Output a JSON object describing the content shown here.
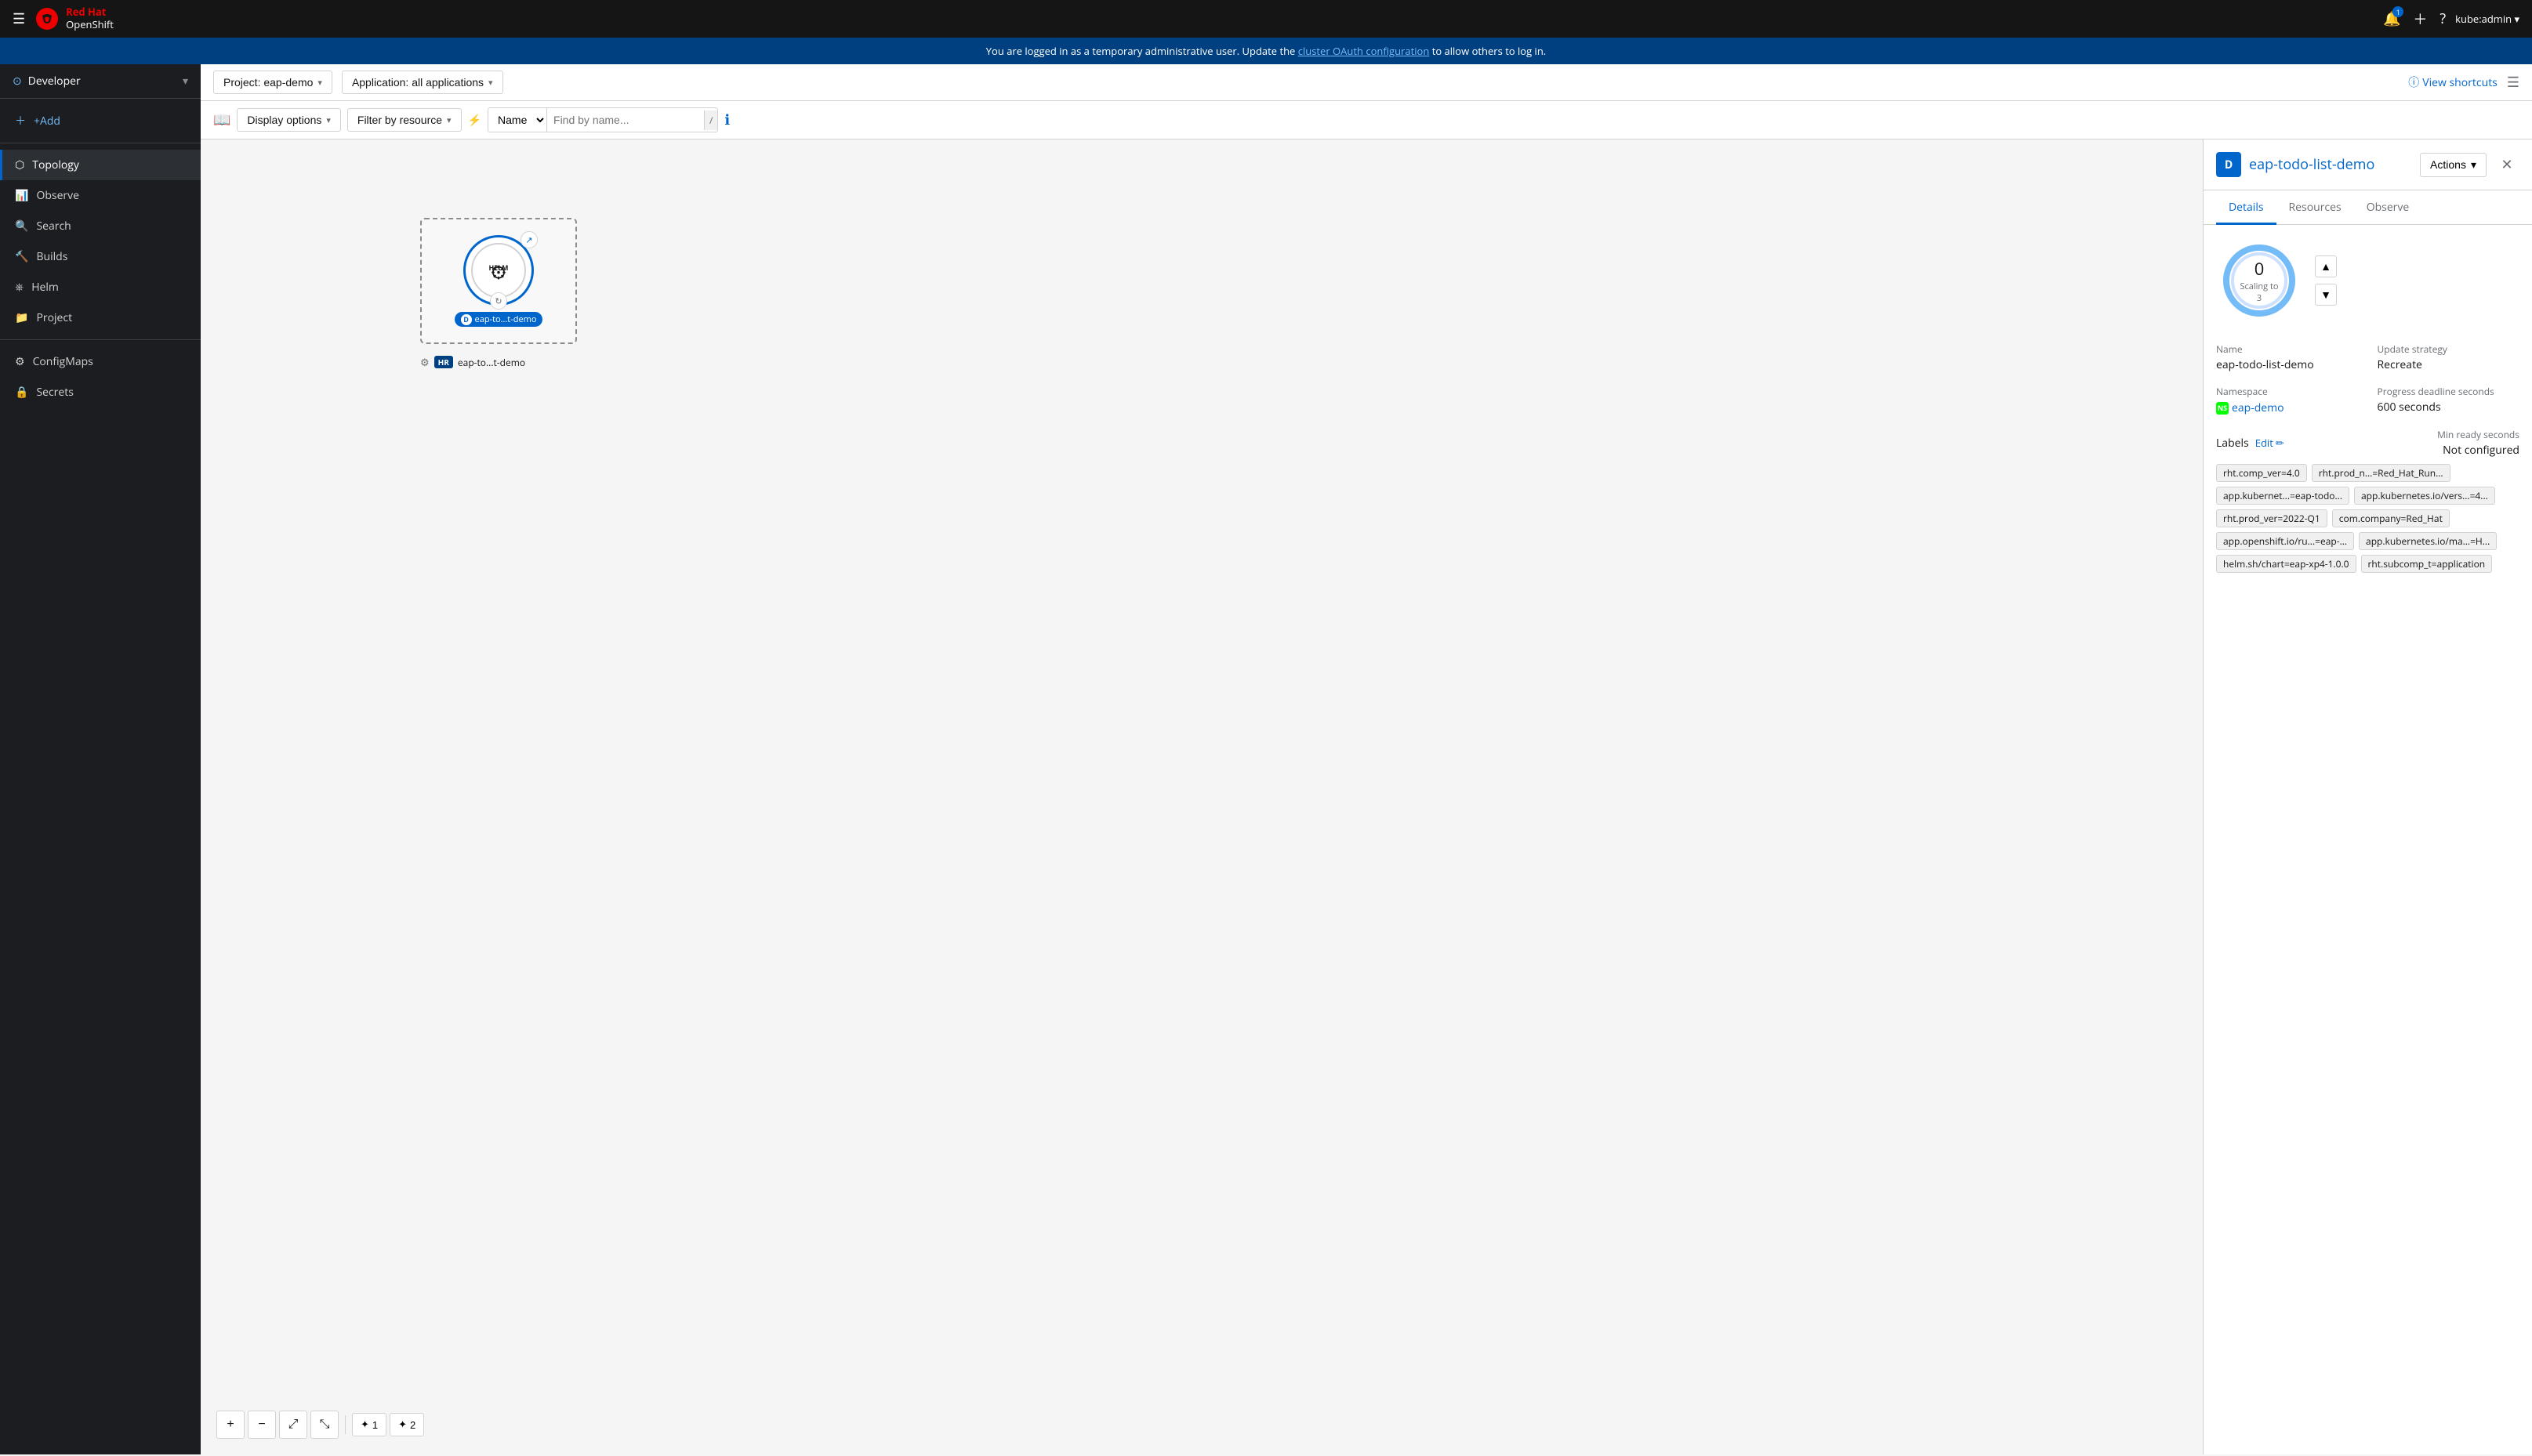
{
  "topnav": {
    "hamburger_label": "☰",
    "brand_red": "Red Hat",
    "brand_product": "OpenShift",
    "notifications_count": "1",
    "user": "kube:admin ▾"
  },
  "banner": {
    "text": "You are logged in as a temporary administrative user. Update the ",
    "link_text": "cluster OAuth configuration",
    "text_after": " to allow others to log in."
  },
  "sidebar": {
    "context_icon": "⊙",
    "context_label": "Developer",
    "context_chevron": "▾",
    "add_label": "+Add",
    "items": [
      {
        "label": "Topology",
        "active": true
      },
      {
        "label": "Observe"
      },
      {
        "label": "Search"
      },
      {
        "label": "Builds"
      },
      {
        "label": "Helm"
      },
      {
        "label": "Project"
      },
      {
        "label": "ConfigMaps"
      },
      {
        "label": "Secrets"
      }
    ]
  },
  "toolbar": {
    "display_options_label": "Display options",
    "filter_by_resource_label": "Filter by resource",
    "name_filter_label": "Name",
    "find_placeholder": "Find by name...",
    "slash_key": "/",
    "view_shortcuts_label": "View shortcuts"
  },
  "project_selector": {
    "label": "Project: eap-demo",
    "chevron": "▾"
  },
  "application_selector": {
    "label": "Application: all applications",
    "chevron": "▾"
  },
  "topology": {
    "node": {
      "label": "eap-to...t-demo",
      "d_badge": "D",
      "hr_badge": "HR",
      "hr_label": "eap-to...t-demo"
    }
  },
  "canvas_controls": {
    "zoom_in": "+",
    "zoom_out": "−",
    "fit": "⤢",
    "reset": "⤡",
    "node1_icon": "✦",
    "node1_label": "1",
    "node2_icon": "✦",
    "node2_label": "2"
  },
  "side_panel": {
    "icon_letter": "D",
    "title": "eap-todo-list-demo",
    "actions_label": "Actions",
    "actions_chevron": "▾",
    "tabs": [
      {
        "label": "Details",
        "active": true
      },
      {
        "label": "Resources"
      },
      {
        "label": "Observe"
      }
    ],
    "scaling": {
      "current": "0",
      "label": "Scaling to",
      "target": "3"
    },
    "details": {
      "name_label": "Name",
      "name_value": "eap-todo-list-demo",
      "update_strategy_label": "Update strategy",
      "update_strategy_value": "Recreate",
      "namespace_label": "Namespace",
      "namespace_ns": "NS",
      "namespace_value": "eap-demo",
      "progress_deadline_label": "Progress deadline seconds",
      "progress_deadline_value": "600 seconds",
      "labels_label": "Labels",
      "edit_label": "Edit",
      "min_ready_label": "Min ready seconds",
      "min_ready_value": "Not configured"
    },
    "labels": [
      "rht.comp_ver=4.0",
      "rht.prod_n...=Red_Hat_Run...",
      "app.kubernet...=eap-todo...",
      "app.kubernetes.io/vers...=4...",
      "rht.prod_ver=2022-Q1",
      "com.company=Red_Hat",
      "app.openshift.io/ru...=eap-...",
      "app.kubernetes.io/ma...=H...",
      "helm.sh/chart=eap-xp4-1.0.0",
      "rht.subcomp_t=application"
    ]
  }
}
